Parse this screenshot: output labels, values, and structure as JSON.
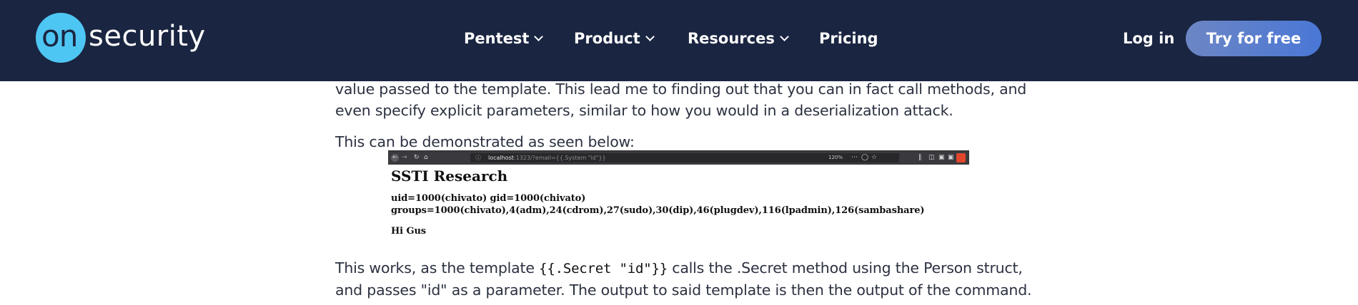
{
  "brand": {
    "logo_on": "on",
    "logo_name": "security"
  },
  "nav": {
    "items": [
      {
        "label": "Pentest",
        "has_dropdown": true
      },
      {
        "label": "Product",
        "has_dropdown": true
      },
      {
        "label": "Resources",
        "has_dropdown": true
      },
      {
        "label": "Pricing",
        "has_dropdown": false
      }
    ],
    "login_label": "Log in",
    "cta_label": "Try for free"
  },
  "article": {
    "para1_line1": "value passed to the template. This lead me to finding out that you can in fact call methods, and",
    "para1_line2": "even specify explicit parameters, similar to how you would in a deserialization attack.",
    "para2": "This can be demonstrated as seen below:",
    "para3_prefix": "This works, as the template ",
    "para3_code": "{{.Secret \"id\"}}",
    "para3_suffix": " calls the .Secret method using the Person struct,",
    "para3_line2": "and passes \"id\" as a parameter. The output to said template is then the output of the command."
  },
  "screenshot": {
    "url_host": "localhost",
    "url_rest": ":1323/?email={{.System \"id\"}}",
    "zoom": "120%",
    "title": "SSTI Research",
    "output_line1": "uid=1000(chivato) gid=1000(chivato)",
    "output_line2": "groups=1000(chivato),4(adm),24(cdrom),27(sudo),30(dip),46(plugdev),116(lpadmin),126(sambashare)",
    "greeting": "Hi Gus"
  },
  "colors": {
    "header_bg": "#1a2541",
    "logo_accent": "#4ec6f3",
    "cta_gradient_start": "#6c86c4",
    "cta_gradient_end": "#4a77d6",
    "body_text": "#2b3140"
  }
}
